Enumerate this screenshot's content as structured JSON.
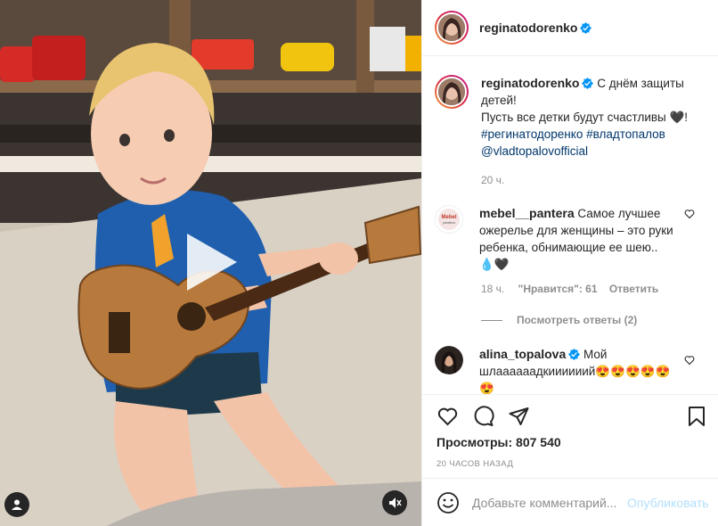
{
  "media": {
    "type": "video",
    "icons": {
      "play": "play-icon",
      "user_tag": "user-tag-icon",
      "mute": "mute-icon"
    }
  },
  "header": {
    "username": "reginatodorenko",
    "verified": true
  },
  "caption": {
    "username": "reginatodorenko",
    "text_line1": "С днём защиты детей!",
    "text_line2": "Пусть все детки будут счастливы 🖤!",
    "hashtag1": "#регинатодоренко",
    "hashtag2": "#владтопалов",
    "mention": "@vladtopalovofficial",
    "time": "20 ч."
  },
  "comments": [
    {
      "username": "mebel__pantera",
      "text": "Самое лучшее ожерелье для женщины – это руки ребенка, обнимающие ее шею.. 💧🖤",
      "time": "18 ч.",
      "likes": "\"Нравится\": 61",
      "reply": "Ответить",
      "view_replies": "Посмотреть ответы (2)"
    },
    {
      "username": "alina_topalova",
      "verified": true,
      "text": "Мой шлаааааадкиииииий😍😍😍😍😍😍"
    }
  ],
  "actions": {
    "icons": [
      "heart-icon",
      "comment-icon",
      "share-icon",
      "bookmark-icon"
    ]
  },
  "stats": {
    "views": "Просмотры: 807 540",
    "time_ago": "20 ЧАСОВ НАЗАД"
  },
  "add_comment": {
    "placeholder": "Добавьте комментарий...",
    "post_label": "Опубликовать"
  },
  "colors": {
    "accent": "#0095f6",
    "post_disabled": "#b2dffc",
    "link": "#00376b",
    "muted": "#8e8e8e",
    "text": "#262626"
  }
}
